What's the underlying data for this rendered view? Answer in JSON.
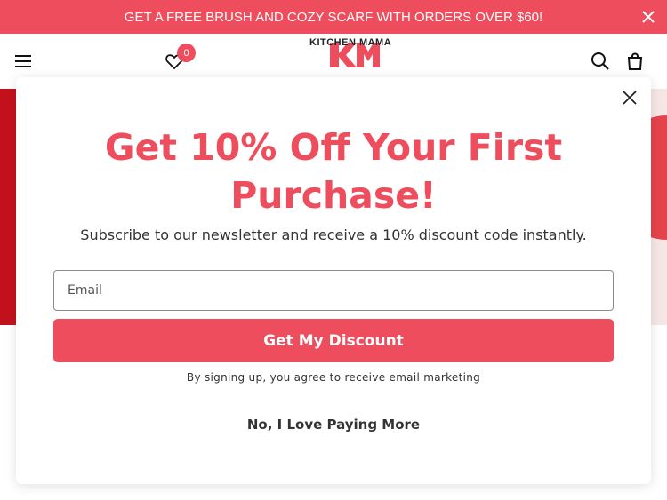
{
  "announcement": {
    "text": "GET A FREE BRUSH AND COZY SCARF WITH ORDERS OVER $60!"
  },
  "header": {
    "logo_text": "KITCHEN MAMA",
    "wishlist_count": "0"
  },
  "popup": {
    "headline": "Get 10% Off Your First Purchase!",
    "subtext": "Subscribe to our newsletter and receive a 10% discount code instantly.",
    "email_placeholder": "Email",
    "cta_label": "Get My Discount",
    "terms": "By signing up, you agree to receive email marketing",
    "decline_label": "No, I Love Paying More"
  },
  "colors": {
    "accent": "#ed4d5c",
    "text": "#333333"
  }
}
